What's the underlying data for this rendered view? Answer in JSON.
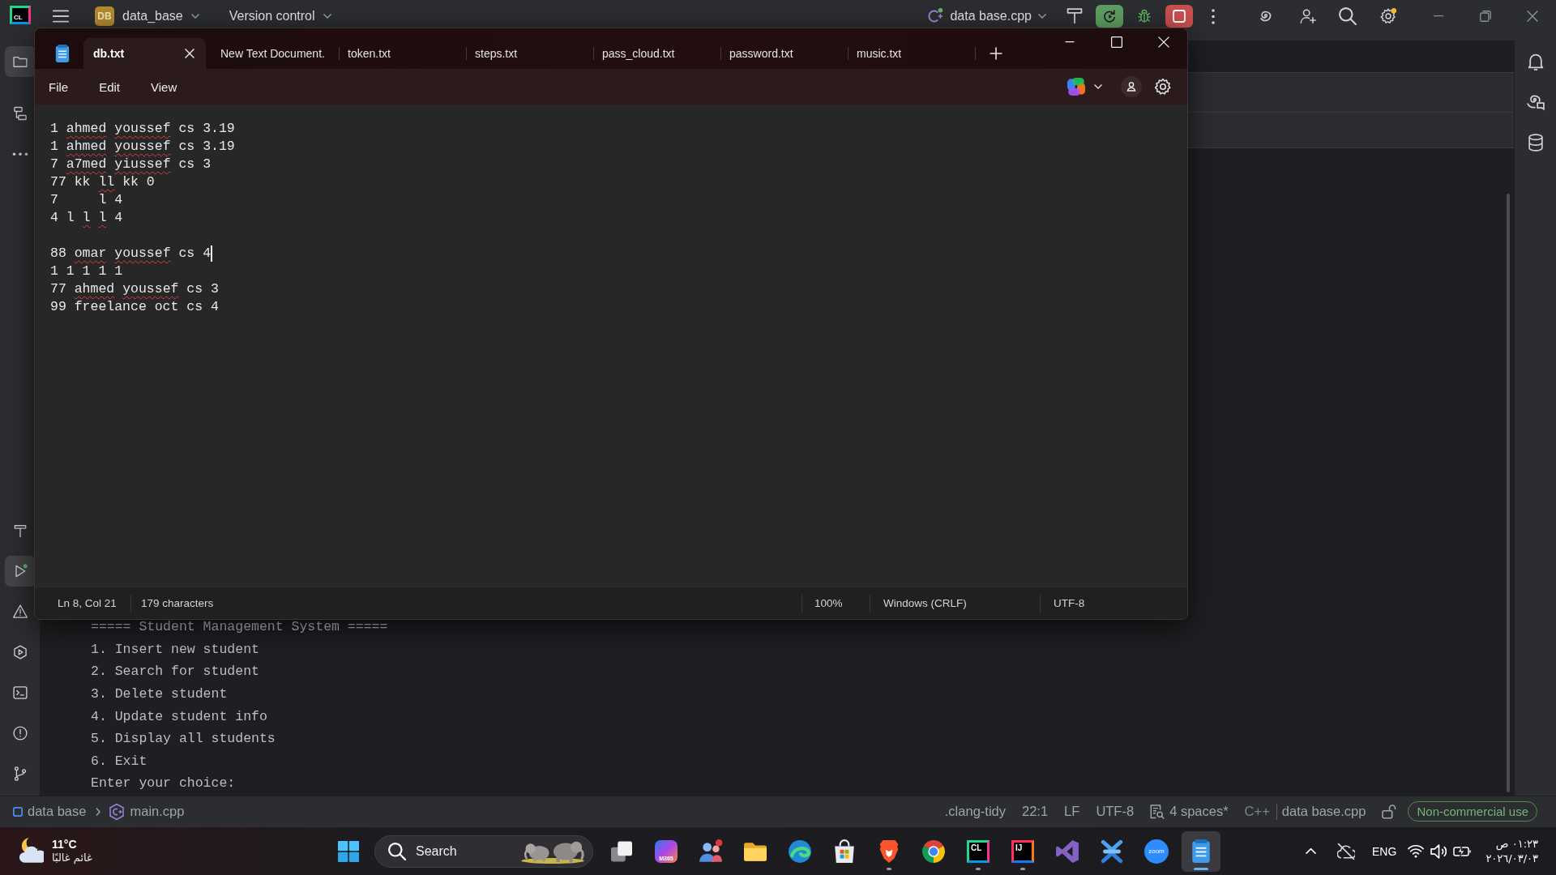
{
  "ide_window": {
    "logo_text": "CL",
    "project_badge": "DB",
    "project": "data_base",
    "vcs": "Version control",
    "run_config": "data base.cpp",
    "left_tools_top": [
      {
        "selected": true
      },
      {
        "selected": false
      },
      {
        "selected": false
      }
    ],
    "left_tools_bottom": [
      {
        "selected": false
      },
      {
        "selected": true
      },
      {
        "selected": false
      },
      {
        "selected": false
      },
      {
        "selected": false
      },
      {
        "selected": false
      },
      {
        "selected": false
      }
    ],
    "terminal_lines": [
      "===== Student Management System =====",
      "1. Insert new student",
      "2. Search for student",
      "3. Delete student",
      "4. Update student info",
      "5. Display all students",
      "6. Exit",
      "Enter your choice:"
    ],
    "status_bar": {
      "breadcrumb": [
        "data base",
        "main.cpp"
      ],
      "inspections": ".clang-tidy",
      "caret_position": "22:1",
      "line_ending": "LF",
      "encoding": "UTF-8",
      "indent": "4 spaces*",
      "language": "C++",
      "file": "data base.cpp",
      "license": "Non-commercial use"
    }
  },
  "notepad_window": {
    "tabs": [
      {
        "label": "db.txt",
        "selected": true
      },
      {
        "label": "New Text Document.",
        "selected": false
      },
      {
        "label": "token.txt",
        "selected": false
      },
      {
        "label": "steps.txt",
        "selected": false
      },
      {
        "label": "pass_cloud.txt",
        "selected": false
      },
      {
        "label": "password.txt",
        "selected": false
      },
      {
        "label": "music.txt",
        "selected": false
      }
    ],
    "menu": [
      "File",
      "Edit",
      "View"
    ],
    "document": {
      "blocks": [
        {
          "lines": [
            {
              "segments": [
                {
                  "text": "1 ",
                  "misspelled": false
                },
                {
                  "text": "ahmed",
                  "misspelled": true
                },
                {
                  "text": " youssef",
                  "misspelled": true
                },
                {
                  "text": " cs 3.19",
                  "misspelled": false
                }
              ],
              "caret": false
            },
            {
              "segments": [
                {
                  "text": "1 ",
                  "misspelled": false
                },
                {
                  "text": "ahmed",
                  "misspelled": true
                },
                {
                  "text": " youssef",
                  "misspelled": true
                },
                {
                  "text": " cs 3.19",
                  "misspelled": false
                }
              ],
              "caret": false
            },
            {
              "segments": [
                {
                  "text": "7 ",
                  "misspelled": false
                },
                {
                  "text": "a7med",
                  "misspelled": true
                },
                {
                  "text": " yiussef",
                  "misspelled": true
                },
                {
                  "text": " cs 3",
                  "misspelled": false
                }
              ],
              "caret": false
            },
            {
              "segments": [
                {
                  "text": "77 kk ",
                  "misspelled": false
                },
                {
                  "text": "ll",
                  "misspelled": true
                },
                {
                  "text": " kk 0",
                  "misspelled": false
                }
              ],
              "caret": false
            },
            {
              "segments": [
                {
                  "text": "7     l 4",
                  "misspelled": false
                }
              ],
              "caret": false
            },
            {
              "segments": [
                {
                  "text": "4 l ",
                  "misspelled": false
                },
                {
                  "text": "l",
                  "misspelled": true
                },
                {
                  "text": " l",
                  "misspelled": true
                },
                {
                  "text": " 4",
                  "misspelled": false
                }
              ],
              "caret": false
            }
          ]
        },
        {
          "lines": [
            {
              "segments": [
                {
                  "text": "88 ",
                  "misspelled": false
                },
                {
                  "text": "omar",
                  "misspelled": true
                },
                {
                  "text": " youssef",
                  "misspelled": true
                },
                {
                  "text": " cs 4",
                  "misspelled": false
                }
              ],
              "caret": true
            },
            {
              "segments": [
                {
                  "text": "1 1 1 1 1",
                  "misspelled": false
                }
              ],
              "caret": false
            },
            {
              "segments": [
                {
                  "text": "77 ",
                  "misspelled": false
                },
                {
                  "text": "ahmed",
                  "misspelled": true
                },
                {
                  "text": " youssef",
                  "misspelled": true
                },
                {
                  "text": " cs 3",
                  "misspelled": false
                }
              ],
              "caret": false
            },
            {
              "segments": [
                {
                  "text": "99 freelance oct cs 4",
                  "misspelled": false
                }
              ],
              "caret": false
            }
          ]
        }
      ]
    },
    "status_bar": {
      "position": "Ln 8, Col 21",
      "characters": "179 characters",
      "zoom": "100%",
      "line_ending": "Windows (CRLF)",
      "encoding": "UTF-8"
    }
  },
  "taskbar": {
    "weather": {
      "temperature": "11°C",
      "condition": "غائم غالبًا"
    },
    "search": {
      "placeholder": "Search"
    },
    "apps": [
      {
        "label": "M365",
        "running": false,
        "selected": false
      },
      {
        "running": false,
        "selected": false
      },
      {
        "running": false,
        "selected": false
      },
      {
        "running": false,
        "selected": false
      },
      {
        "running": false,
        "selected": false
      },
      {
        "running": true,
        "selected": false
      },
      {
        "running": false,
        "selected": false
      },
      {
        "label": "CL",
        "running": true,
        "selected": false
      },
      {
        "label": "IJ",
        "running": true,
        "selected": false
      },
      {
        "running": false,
        "selected": false
      },
      {
        "running": false,
        "selected": false
      },
      {
        "label": "zoom",
        "running": false,
        "selected": false
      },
      {
        "running": true,
        "selected": true
      }
    ],
    "tray": {
      "language": "ENG",
      "time": "٠١:٢٣ ص",
      "date": "٢٠٢٦/٠٣/٠٣"
    }
  }
}
